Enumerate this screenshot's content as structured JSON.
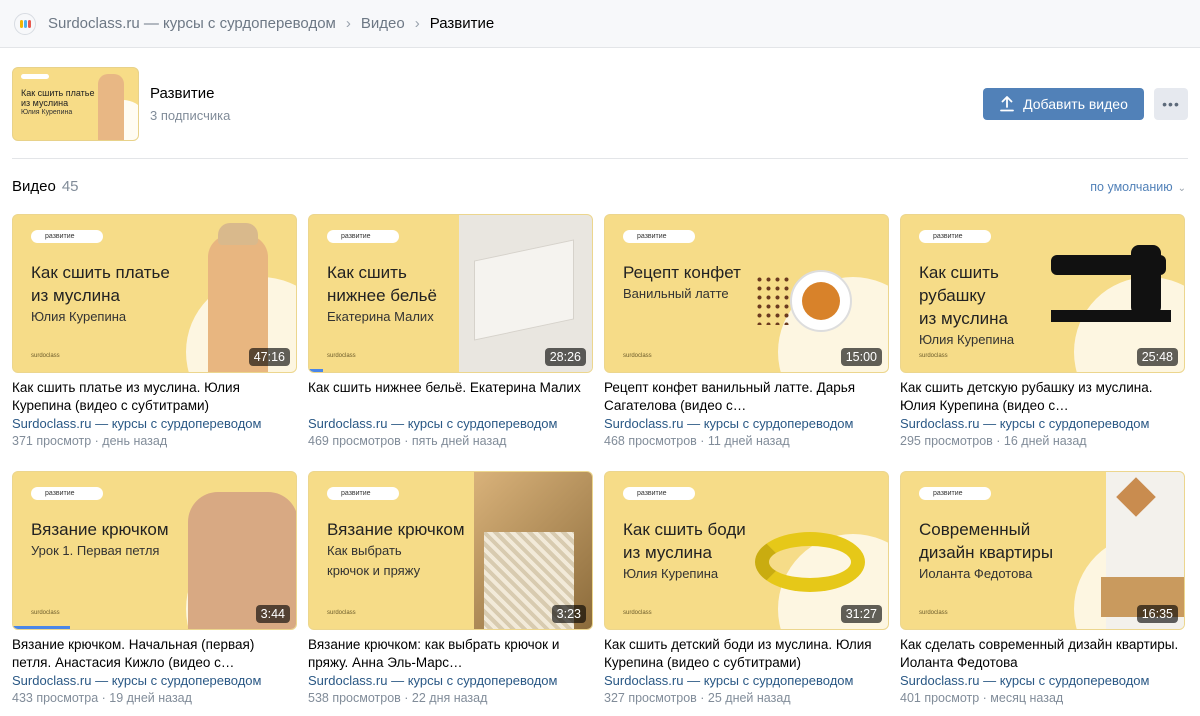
{
  "breadcrumbs": [
    "Surdoclass.ru — курсы с сурдопереводом",
    "Видео",
    "Развитие"
  ],
  "album": {
    "title": "Развитие",
    "subscribers": "3 подписчика",
    "cover_title": "Как сшить платье\nиз муслина",
    "cover_sub": "Юлия Курепина",
    "add_button": "Добавить видео",
    "more_button": "•••"
  },
  "videos_section": {
    "label": "Видео",
    "count": "45",
    "sort_label": "по умолчанию"
  },
  "videos": [
    {
      "thumb_title": "Как сшить платье\nиз муслина",
      "thumb_sub": "Юлия Курепина",
      "duration": "47:16",
      "title": "Как сшить платье из муслина. Юлия Курепина (видео с субтитрами)",
      "channel": "Surdoclass.ru — курсы с сурдопереводом",
      "meta": "371 просмотр · день назад",
      "progress": 0
    },
    {
      "thumb_title": "Как сшить\nнижнее бельё",
      "thumb_sub": "Екатерина Малих",
      "duration": "28:26",
      "title": "Как сшить нижнее бельё. Екатерина Малих",
      "channel": "Surdoclass.ru — курсы с сурдопереводом",
      "meta": "469 просмотров · пять дней назад",
      "progress": 0.05
    },
    {
      "thumb_title": "Рецепт конфет",
      "thumb_sub": "Ванильный латте",
      "duration": "15:00",
      "title": "Рецепт конфет ванильный латте. Дарья Сагателова (видео с…",
      "channel": "Surdoclass.ru — курсы с сурдопереводом",
      "meta": "468 просмотров · 11 дней назад",
      "progress": 0
    },
    {
      "thumb_title": "Как сшить\nрубашку\nиз муслина",
      "thumb_sub": "Юлия Курепина",
      "duration": "25:48",
      "title": "Как сшить детскую рубашку из муслина. Юлия Курепина (видео с…",
      "channel": "Surdoclass.ru — курсы с сурдопереводом",
      "meta": "295 просмотров · 16 дней назад",
      "progress": 0
    },
    {
      "thumb_title": "Вязание крючком",
      "thumb_sub": "Урок 1. Первая петля",
      "duration": "3:44",
      "title": "Вязание крючком. Начальная (первая) петля. Анастасия Кижло (видео с…",
      "channel": "Surdoclass.ru — курсы с сурдопереводом",
      "meta": "433 просмотра · 19 дней назад",
      "progress": 0.2
    },
    {
      "thumb_title": "Вязание крючком",
      "thumb_sub": "Как выбрать\nкрючок и пряжу",
      "duration": "3:23",
      "title": "Вязание крючком: как выбрать крючок и пряжу. Анна Эль-Марс…",
      "channel": "Surdoclass.ru — курсы с сурдопереводом",
      "meta": "538 просмотров · 22 дня назад",
      "progress": 0
    },
    {
      "thumb_title": "Как сшить боди\nиз муслина",
      "thumb_sub": "Юлия Курепина",
      "duration": "31:27",
      "title": "Как сшить детский боди из муслина. Юлия Курепина (видео с субтитрами)",
      "channel": "Surdoclass.ru — курсы с сурдопереводом",
      "meta": "327 просмотров · 25 дней назад",
      "progress": 0
    },
    {
      "thumb_title": "Современный\nдизайн квартиры",
      "thumb_sub": "Иоланта Федотова",
      "duration": "16:35",
      "title": "Как сделать современный дизайн квартиры. Иоланта Федотова",
      "channel": "Surdoclass.ru — курсы с сурдопереводом",
      "meta": "401 просмотр · месяц назад",
      "progress": 0
    }
  ],
  "thumb_tag": "развитие",
  "thumb_brand": "surdoclass",
  "colors": {
    "accent": "#5181b8",
    "link": "#2a5885",
    "thumb_bg": "#f6dc88"
  }
}
